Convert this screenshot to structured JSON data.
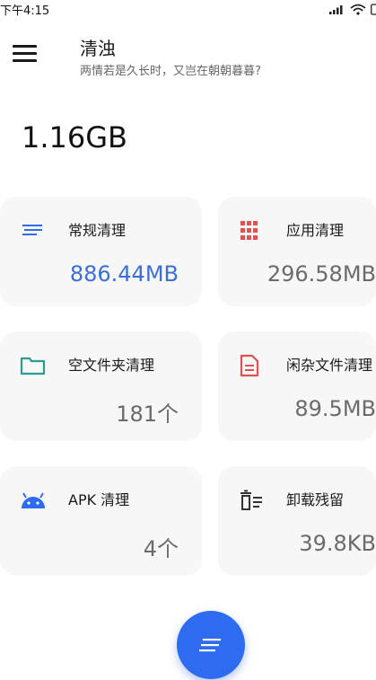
{
  "status_bar": {
    "time": "下午4:15"
  },
  "header": {
    "title": "清浊",
    "subtitle": "两情若是久长时，又岂在朝朝暮暮?"
  },
  "total_size": "1.16GB",
  "cards": [
    {
      "label": "常规清理",
      "value": "886.44MB",
      "icon": "lines-icon",
      "color": "#2f6bf0"
    },
    {
      "label": "应用清理",
      "value": "296.58MB",
      "icon": "grid-icon",
      "color": "#e05252"
    },
    {
      "label": "空文件夹清理",
      "value": "181个",
      "icon": "folder-icon",
      "color": "#2a9d8f"
    },
    {
      "label": "闲杂文件清理",
      "value": "89.5MB",
      "icon": "document-icon",
      "color": "#e05252"
    },
    {
      "label": "APK 清理",
      "value": "4个",
      "icon": "android-icon",
      "color": "#2f6bf0"
    },
    {
      "label": "卸载残留",
      "value": "39.8KB",
      "icon": "trash-icon",
      "color": "#333333"
    }
  ],
  "colors": {
    "accent": "#2f6bf0",
    "value_accent": "#3a6fd8",
    "card_bg": "#f7f7f7"
  }
}
